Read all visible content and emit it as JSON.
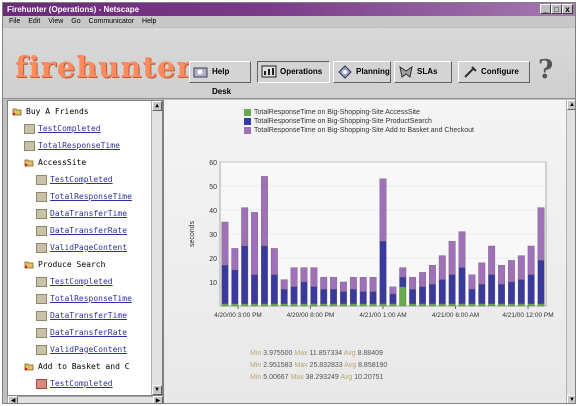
{
  "window": {
    "title": "Firehunter (Operations) - Netscape",
    "controls": [
      "_",
      "□",
      "x"
    ]
  },
  "menu": [
    "File",
    "Edit",
    "View",
    "Go",
    "Communicator",
    "Help"
  ],
  "brand": {
    "logo": "firehunter",
    "color": "#ff8a5c"
  },
  "nav": [
    {
      "label": "Help Desk",
      "icon": "help-desk-icon"
    },
    {
      "label": "Operations",
      "icon": "operations-icon",
      "active": true
    },
    {
      "label": "Planning",
      "icon": "planning-icon"
    },
    {
      "label": "SLAs",
      "icon": "sla-icon"
    },
    {
      "label": "Configure",
      "icon": "configure-icon"
    }
  ],
  "help_label": "?",
  "tree": [
    {
      "label": "Buy A Friends",
      "type": "folder",
      "level": 0
    },
    {
      "label": "TestCompleted",
      "type": "leaf",
      "level": 1
    },
    {
      "label": "TotalResponseTime",
      "type": "leaf",
      "level": 1
    },
    {
      "label": "AccessSite",
      "type": "folder",
      "level": 1
    },
    {
      "label": "TestCompleted",
      "type": "leaf",
      "level": 2
    },
    {
      "label": "TotalResponseTime",
      "type": "leaf",
      "level": 2
    },
    {
      "label": "DataTransferTime",
      "type": "leaf",
      "level": 2
    },
    {
      "label": "DataTransferRate",
      "type": "leaf",
      "level": 2
    },
    {
      "label": "ValidPageContent",
      "type": "leaf",
      "level": 2
    },
    {
      "label": "Produce Search",
      "type": "folder",
      "level": 1
    },
    {
      "label": "TestCompleted",
      "type": "leaf",
      "level": 2
    },
    {
      "label": "TotalResponseTime",
      "type": "leaf",
      "level": 2
    },
    {
      "label": "DataTransferTime",
      "type": "leaf",
      "level": 2
    },
    {
      "label": "DataTransferRate",
      "type": "leaf",
      "level": 2
    },
    {
      "label": "ValidPageContent",
      "type": "leaf",
      "level": 2
    },
    {
      "label": "Add to Basket and C",
      "type": "folder",
      "level": 1
    },
    {
      "label": "TestCompleted",
      "type": "leaf-red",
      "level": 2
    }
  ],
  "chart_data": {
    "type": "bar",
    "stacked": true,
    "ylabel": "seconds",
    "ylim": [
      0,
      60
    ],
    "yticks": [
      10,
      20,
      30,
      40,
      50,
      60
    ],
    "xtick_labels": [
      "4/20/00 3:00 PM",
      "4/20/00 8:00 PM",
      "4/21/00 1:00 AM",
      "4/21/00 6:00 AM",
      "4/21/00 12:00 PM"
    ],
    "series": [
      {
        "name": "TotalResponseTime on Big-Shopping-Site AccessSite",
        "color": "#6aa84f",
        "values": [
          1,
          1,
          1,
          1,
          1,
          1,
          1,
          1,
          1,
          1,
          1,
          1,
          1,
          1,
          1,
          1,
          1,
          1,
          8,
          1,
          1,
          1,
          1,
          1,
          1,
          1,
          1,
          1,
          1,
          1,
          1,
          1,
          1
        ]
      },
      {
        "name": "TotalResponseTime on Big-Shopping-Site ProductSearch",
        "color": "#3a3a9e",
        "values": [
          16,
          14,
          24,
          12,
          24,
          12,
          6,
          7,
          9,
          7,
          6,
          6,
          5,
          6,
          5,
          5,
          26,
          4,
          4,
          6,
          7,
          8,
          10,
          12,
          15,
          6,
          8,
          12,
          8,
          9,
          10,
          12,
          18
        ]
      },
      {
        "name": "TotalResponseTime on Big-Shopping-Site Add to Basket and Checkout",
        "color": "#a070b8",
        "values": [
          18,
          9,
          16,
          26,
          29,
          11,
          4,
          8,
          6,
          8,
          5,
          5,
          4,
          5,
          6,
          6,
          26,
          3,
          4,
          5,
          6,
          8,
          10,
          14,
          15,
          6,
          9,
          12,
          8,
          9,
          10,
          12,
          22
        ]
      }
    ]
  },
  "stats": [
    {
      "min_label": "Min",
      "min": "3.975500",
      "max_label": "Max",
      "max": "11.857334",
      "avg_label": "Avg",
      "avg": "8.88409"
    },
    {
      "min_label": "Min",
      "min": "2.951583",
      "max_label": "Max",
      "max": "25.832833",
      "avg_label": "Avg",
      "avg": "8.858190"
    },
    {
      "min_label": "Min",
      "min": "5.00667",
      "max_label": "Max",
      "max": "38.293249",
      "avg_label": "Avg",
      "avg": "10.20751"
    }
  ]
}
